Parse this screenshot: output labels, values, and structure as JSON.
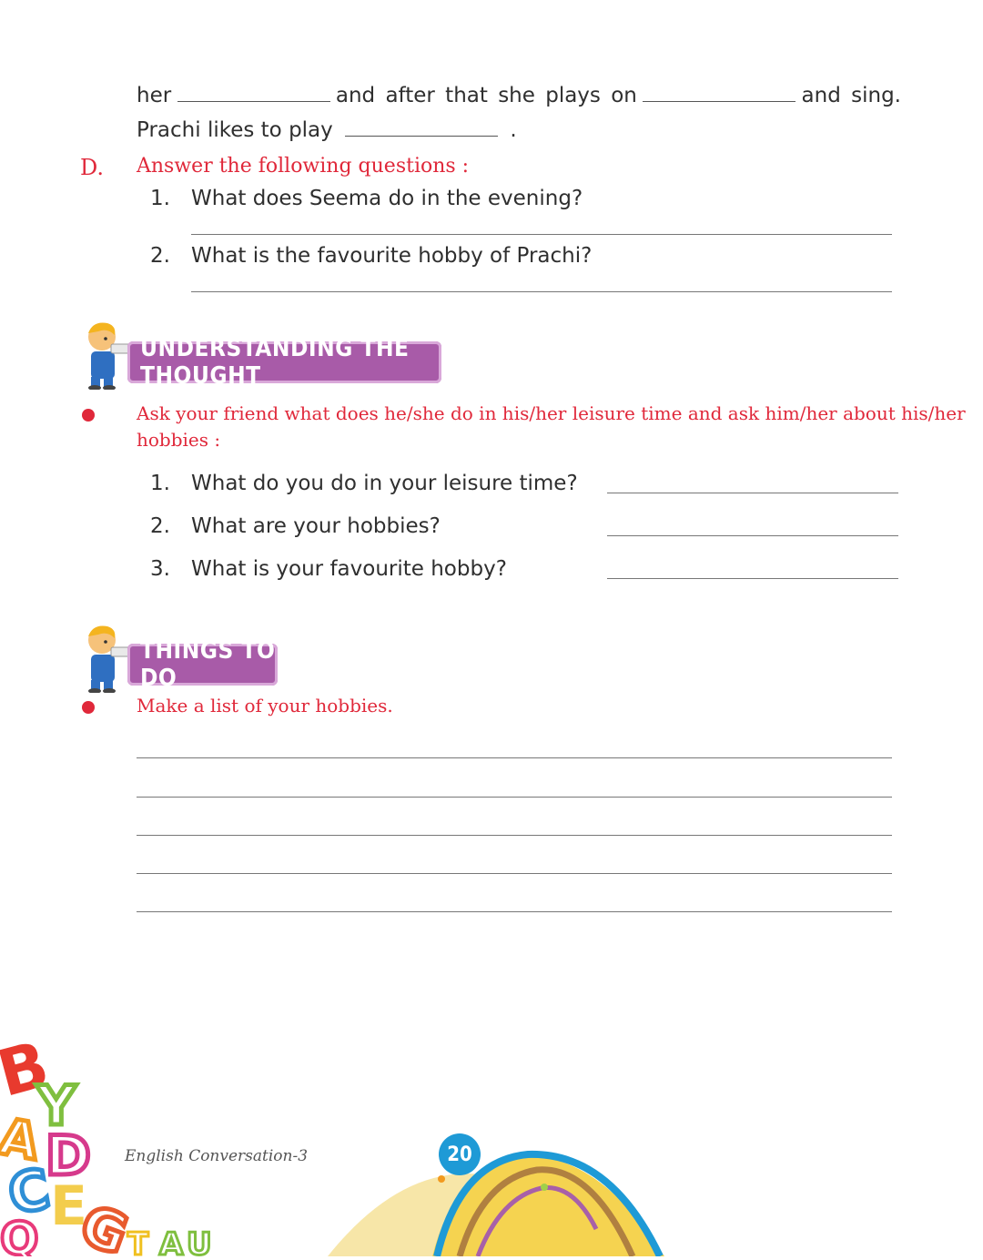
{
  "fill_in": {
    "line1_word1": "her",
    "line1_word2": "and after that she plays on",
    "line1_word3": "and sing.",
    "line2_text": "Prachi likes to play",
    "line2_end": "."
  },
  "section_d": {
    "letter": "D.",
    "instruction": "Answer the following questions :",
    "questions": [
      {
        "num": "1.",
        "text": "What does Seema do in the evening?"
      },
      {
        "num": "2.",
        "text": "What is the favourite hobby of Prachi?"
      }
    ]
  },
  "understanding": {
    "banner": "UNDERSTANDING THE THOUGHT",
    "instruction_line1": "Ask your friend what does he/she do in his/her leisure time and ask him/her about his/her",
    "instruction_line2": "hobbies :",
    "questions": [
      {
        "num": "1.",
        "text": "What do you do in your leisure time?"
      },
      {
        "num": "2.",
        "text": "What are your hobbies?"
      },
      {
        "num": "3.",
        "text": "What is your favourite hobby?"
      }
    ]
  },
  "things_to_do": {
    "banner": "THINGS TO DO",
    "instruction": "Make a list of your hobbies."
  },
  "footer": {
    "book_title": "English Conversation-3",
    "page_number": "20"
  },
  "colors": {
    "accent_red": "#e0283a",
    "banner_purple": "#a85ba8",
    "page_badge_blue": "#1e9ad6"
  }
}
